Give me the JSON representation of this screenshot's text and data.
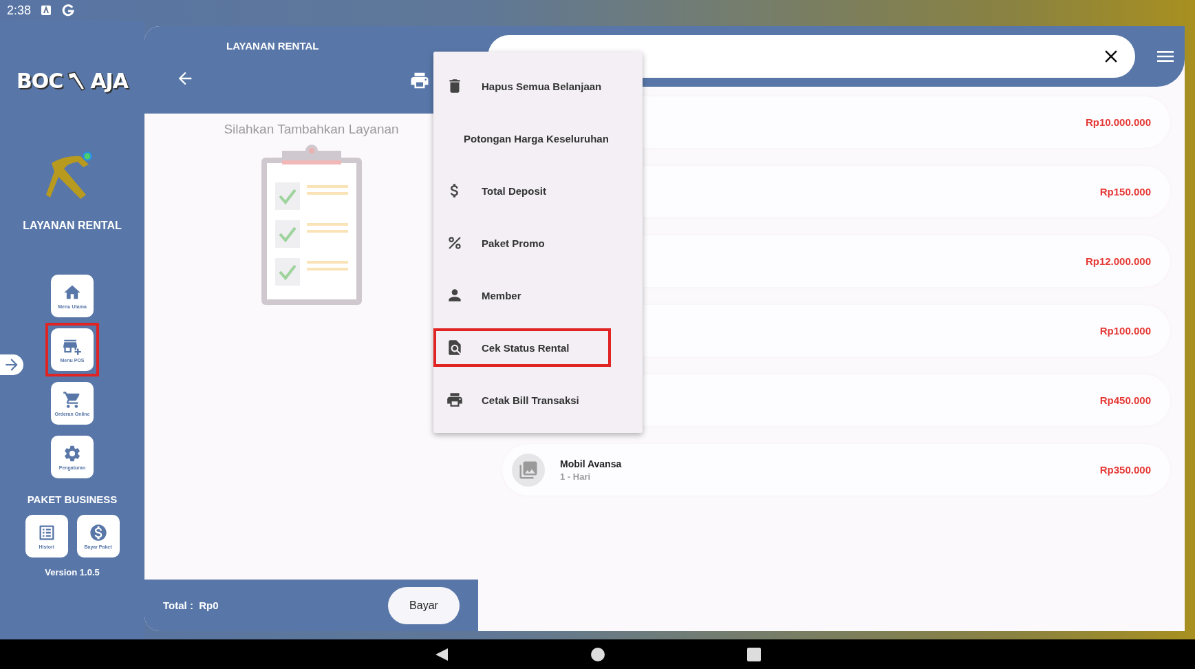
{
  "status_bar": {
    "time": "2:38"
  },
  "sidebar": {
    "logo": {
      "left": "BOC",
      "right": "AJA"
    },
    "title": "LAYANAN RENTAL",
    "nav": [
      {
        "label": "Menu Utama",
        "selected": false
      },
      {
        "label": "Menu POS",
        "selected": true
      },
      {
        "label": "Orderan Online",
        "selected": false
      },
      {
        "label": "Pengaturan",
        "selected": false
      }
    ],
    "section_title": "PAKET BUSINESS",
    "package_buttons": [
      {
        "label": "Histori"
      },
      {
        "label": "Bayar Paket"
      }
    ],
    "version": "Version 1.0.5"
  },
  "cart": {
    "title": "LAYANAN RENTAL",
    "empty_message": "Silahkan Tambahkan Layanan",
    "total_label": "Total :",
    "total_value": "Rp0",
    "pay_button": "Bayar"
  },
  "products": [
    {
      "price": "Rp10.000.000"
    },
    {
      "price": "Rp150.000"
    },
    {
      "price": "Rp12.000.000"
    },
    {
      "price": "Rp100.000"
    },
    {
      "price": "Rp450.000"
    },
    {
      "name": "Mobil Avansa",
      "duration": "1 - Hari",
      "price": "Rp350.000"
    }
  ],
  "menu": [
    {
      "label": "Hapus Semua Belanjaan",
      "highlighted": false
    },
    {
      "label": "Potongan Harga Keseluruhan",
      "highlighted": false
    },
    {
      "label": "Total Deposit",
      "highlighted": false
    },
    {
      "label": "Paket Promo",
      "highlighted": false
    },
    {
      "label": "Member",
      "highlighted": false
    },
    {
      "label": "Cek Status Rental",
      "highlighted": true
    },
    {
      "label": "Cetak Bill Transaksi",
      "highlighted": false
    }
  ]
}
